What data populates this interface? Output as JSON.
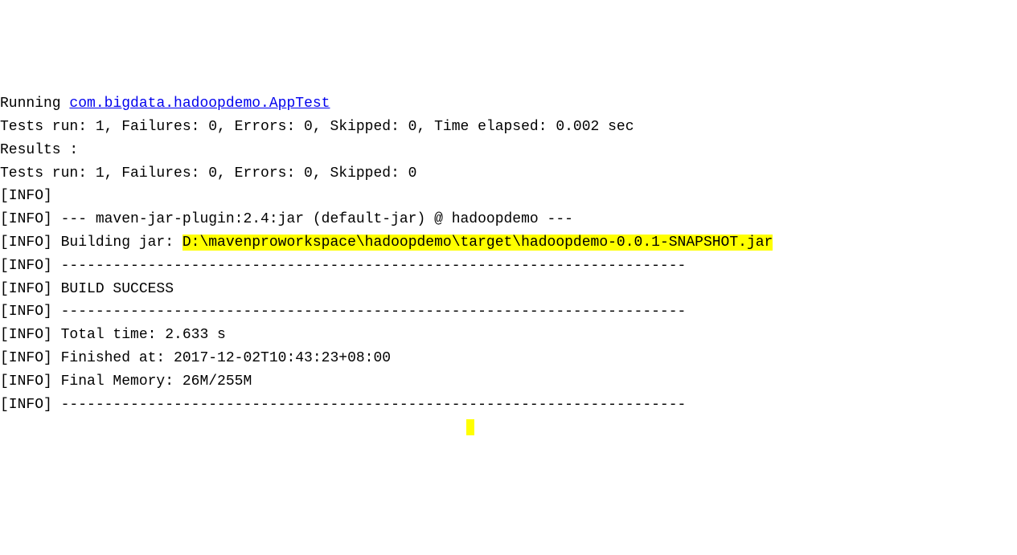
{
  "lines": {
    "running_prefix": "Running ",
    "test_class_link": "com.bigdata.hadoopdemo.AppTest",
    "tests_line1": "Tests run: 1, Failures: 0, Errors: 0, Skipped: 0, Time elapsed: 0.002 sec",
    "empty1": "",
    "results_label": "Results :",
    "empty2": "",
    "tests_line2": "Tests run: 1, Failures: 0, Errors: 0, Skipped: 0",
    "empty3": "",
    "info1": "[INFO]",
    "info2": "[INFO] --- maven-jar-plugin:2.4:jar (default-jar) @ hadoopdemo ---",
    "building_jar_prefix": "[INFO] Building jar: ",
    "jar_path": "D:\\mavenproworkspace\\hadoopdemo\\target\\hadoopdemo-0.0.1-SNAPSHOT.jar",
    "info4": "[INFO] ------------------------------------------------------------------------",
    "info5": "[INFO] BUILD SUCCESS",
    "info6": "[INFO] ------------------------------------------------------------------------",
    "info7": "[INFO] Total time: 2.633 s",
    "info8": "[INFO] Finished at: 2017-12-02T10:43:23+08:00",
    "info9": "[INFO] Final Memory: 26M/255M",
    "info10": "[INFO] ------------------------------------------------------------------------"
  }
}
